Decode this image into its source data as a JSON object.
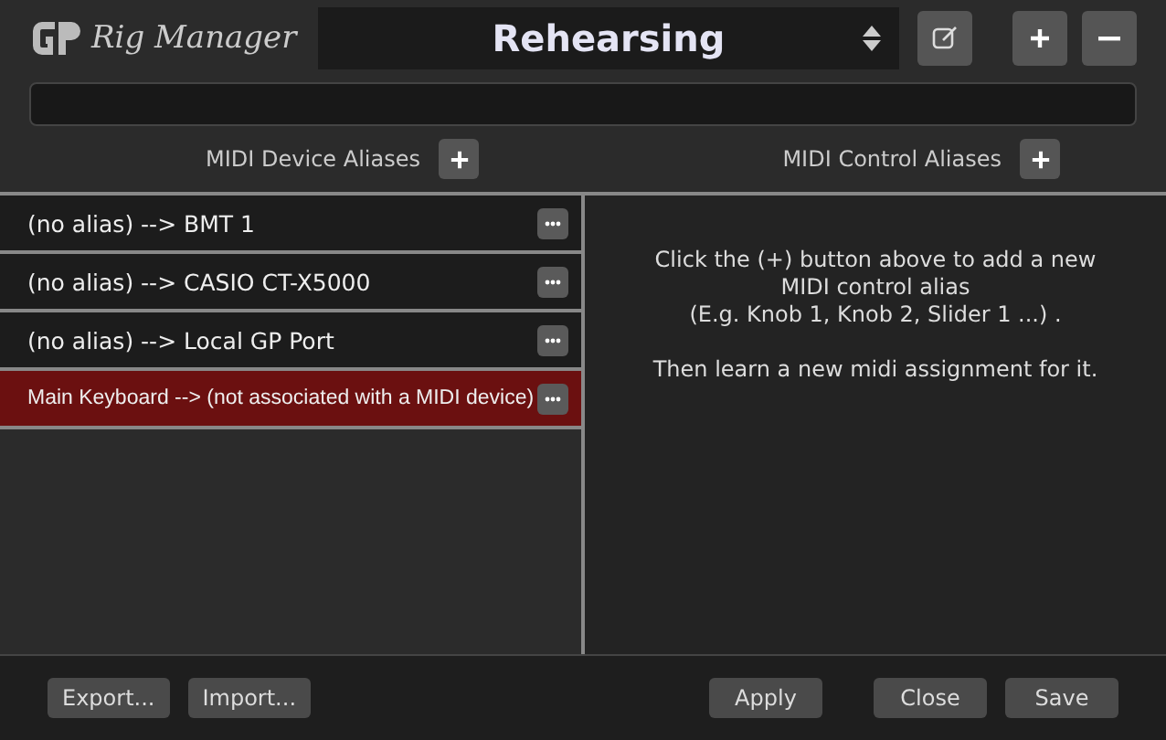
{
  "header": {
    "app_name": "Rig Manager",
    "rig_selector": {
      "value": "Rehearsing"
    }
  },
  "device_aliases": {
    "title": "MIDI Device Aliases",
    "rows": [
      {
        "label": "(no alias) --> BMT 1",
        "selected": false
      },
      {
        "label": "(no alias) --> CASIO CT-X5000",
        "selected": false
      },
      {
        "label": "(no alias) --> Local GP Port",
        "selected": false
      },
      {
        "label": "Main Keyboard --> (not associated with a MIDI device)",
        "selected": true
      }
    ]
  },
  "control_aliases": {
    "title": "MIDI Control Aliases",
    "hint_lines": [
      "Click the (+) button above to add a new",
      "MIDI control alias",
      "(E.g. Knob 1, Knob 2, Slider 1 ...) ."
    ],
    "hint_second": "Then learn a new midi assignment for it."
  },
  "footer": {
    "left_buttons": [
      "Export...",
      "Import..."
    ],
    "right_buttons": [
      "Apply",
      "Close",
      "Save"
    ]
  }
}
